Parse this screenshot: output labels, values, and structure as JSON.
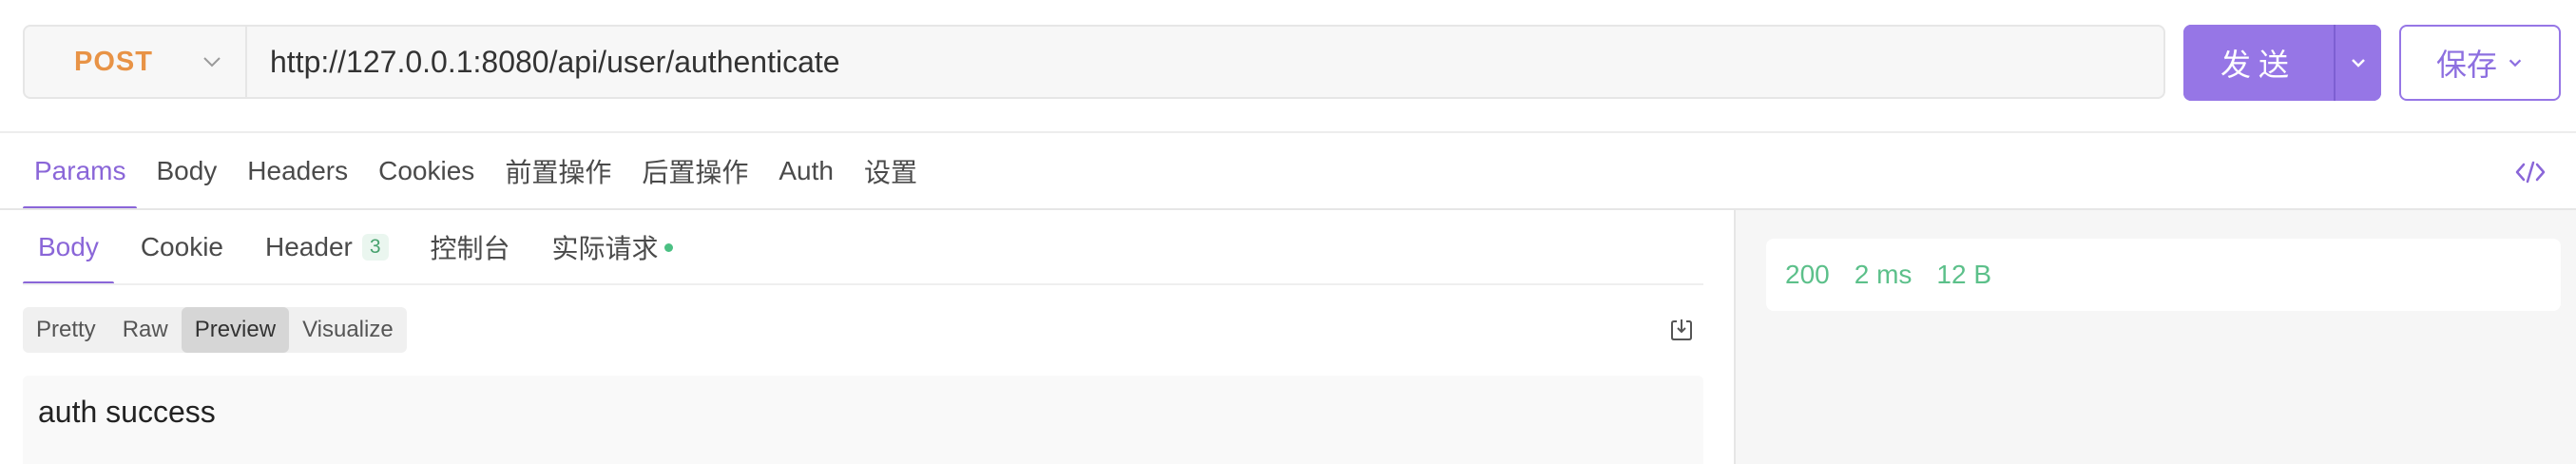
{
  "request": {
    "method": "POST",
    "url": "http://127.0.0.1:8080/api/user/authenticate",
    "send_label": "发送",
    "save_label": "保存"
  },
  "request_tabs": [
    {
      "label": "Params",
      "active": true
    },
    {
      "label": "Body"
    },
    {
      "label": "Headers"
    },
    {
      "label": "Cookies"
    },
    {
      "label": "前置操作"
    },
    {
      "label": "后置操作"
    },
    {
      "label": "Auth"
    },
    {
      "label": "设置"
    }
  ],
  "response": {
    "tabs": [
      {
        "label": "Body",
        "active": true
      },
      {
        "label": "Cookie"
      },
      {
        "label": "Header",
        "badge": "3"
      },
      {
        "label": "控制台"
      },
      {
        "label": "实际请求",
        "dot": true
      }
    ],
    "view_modes": [
      {
        "label": "Pretty"
      },
      {
        "label": "Raw"
      },
      {
        "label": "Preview",
        "active": true
      },
      {
        "label": "Visualize"
      }
    ],
    "preview_text": "auth success",
    "status": {
      "code": "200",
      "time": "2 ms",
      "size": "12 B"
    }
  },
  "colors": {
    "accent": "#8a66d8",
    "method_post": "#e89346",
    "status_ok": "#5cc08a"
  },
  "icons": {
    "method_dropdown": "chevron-down-icon",
    "send_dropdown": "chevron-down-icon",
    "save_dropdown": "chevron-down-icon",
    "code": "code-icon",
    "download": "download-icon"
  }
}
